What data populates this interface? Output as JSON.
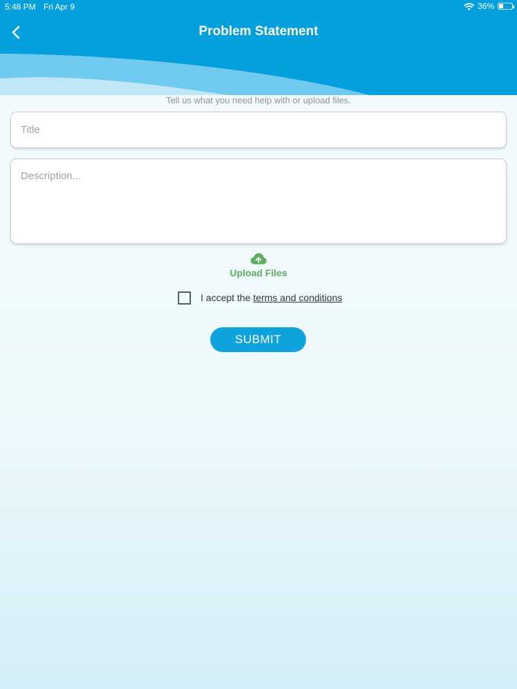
{
  "status_bar": {
    "time": "5:48 PM",
    "date": "Fri Apr 9",
    "battery": "36%",
    "battery_level": 0.36
  },
  "header": {
    "title": "Problem Statement",
    "back_icon": "chevron-left-icon"
  },
  "form": {
    "subtitle": "Tell us what you need help with or upload files.",
    "title_placeholder": "Title",
    "title_value": "",
    "description_placeholder": "Description...",
    "description_value": "",
    "upload_label": "Upload Files",
    "upload_icon": "cloud-upload-icon",
    "accept_prefix": "I accept the",
    "terms_link": "terms and conditions",
    "terms_checked": false,
    "submit_label": "SUBMIT"
  },
  "colors": {
    "header_blue": "#049fdd",
    "accent_green": "#5fae5f",
    "submit_blue": "#0ea3dc"
  }
}
